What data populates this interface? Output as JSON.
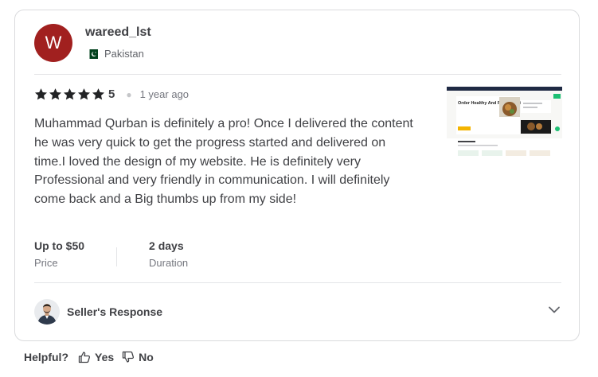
{
  "reviewer": {
    "avatar_letter": "W",
    "avatar_color": "#a1201f",
    "username": "wareed_lst",
    "country": "Pakistan",
    "flag_icon": "pakistan-flag-icon"
  },
  "review": {
    "rating": 5,
    "rating_label": "5",
    "time_ago": "1 year ago",
    "text": "Muhammad Qurban is definitely a pro! Once I delivered the content he was very quick to get the progress started and delivered on time.I loved the design of my website. He is definitely very Professional and very friendly in communication. I will definitely come back and a Big thumbs up from my side!",
    "thumbnail_heading": "Order Healthy And Fresh Food Any Time"
  },
  "meta": {
    "price_value": "Up to $50",
    "price_label": "Price",
    "duration_value": "2 days",
    "duration_label": "Duration"
  },
  "seller_response": {
    "label": "Seller's Response",
    "expand_icon": "chevron-down-icon"
  },
  "helpful": {
    "label": "Helpful?",
    "yes_label": "Yes",
    "no_label": "No"
  },
  "colors": {
    "star": "#222325",
    "text": "#404145",
    "muted": "#74767e",
    "border": "#dadbdd"
  }
}
